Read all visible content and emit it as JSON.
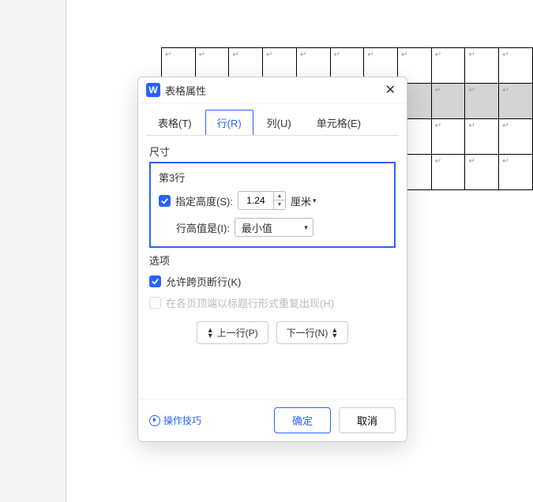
{
  "dialog": {
    "title": "表格属性",
    "app_icon_letter": "W",
    "tabs": {
      "table": "表格(T)",
      "row": "行(R)",
      "column": "列(U)",
      "cell": "单元格(E)"
    },
    "size_section_label": "尺寸",
    "row_label": "第3行",
    "specify_height_label": "指定高度(S):",
    "height_value": "1.24",
    "unit_label": "厘米",
    "row_height_is_label": "行高值是(I):",
    "row_height_is_value": "最小值",
    "options_section_label": "选项",
    "allow_break_label": "允许跨页断行(K)",
    "repeat_header_label": "在各页顶端以标题行形式重复出现(H)",
    "prev_row_label": "上一行(P)",
    "next_row_label": "下一行(N)",
    "tips_label": "操作技巧",
    "ok_label": "确定",
    "cancel_label": "取消"
  },
  "cell_mark": "↵"
}
